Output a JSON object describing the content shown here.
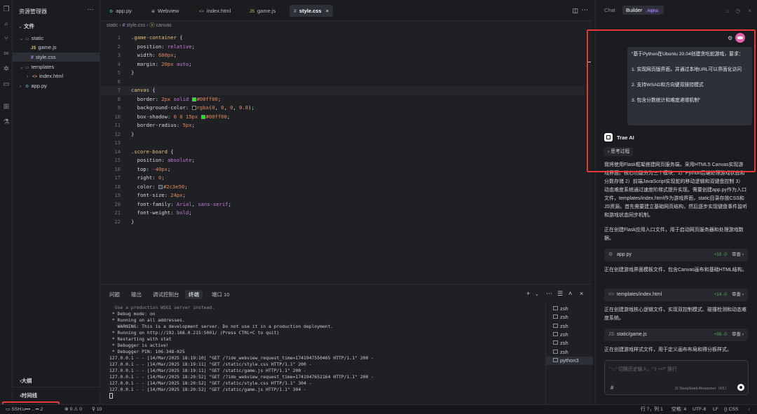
{
  "explorer": {
    "title": "资源管理器",
    "more": "···",
    "section_files": "文件",
    "items": [
      {
        "label": "static",
        "kind": "folder"
      },
      {
        "label": "game.js",
        "kind": "js"
      },
      {
        "label": "style.css",
        "kind": "css"
      },
      {
        "label": "templates",
        "kind": "folder"
      },
      {
        "label": "index.html",
        "kind": "html"
      },
      {
        "label": "app.py",
        "kind": "py"
      }
    ],
    "outline": "大纲",
    "timeline": "时间线"
  },
  "tabs": [
    {
      "icon": "py",
      "label": "app.py"
    },
    {
      "icon": "web",
      "label": "Webview"
    },
    {
      "icon": "<>",
      "label": "index.html"
    },
    {
      "icon": "JS",
      "label": "game.js"
    },
    {
      "icon": "#",
      "label": "style.css",
      "close": "×"
    }
  ],
  "breadcrumb": {
    "p1": "static",
    "p2": "style.css",
    "p3": "canvas"
  },
  "code": [
    {
      "n": "1",
      "t": ".game-container {"
    },
    {
      "n": "2",
      "t": "  position: relative;"
    },
    {
      "n": "3",
      "t": "  width: 600px;"
    },
    {
      "n": "4",
      "t": "  margin: 20px auto;"
    },
    {
      "n": "5",
      "t": "}"
    },
    {
      "n": "6",
      "t": ""
    },
    {
      "n": "7",
      "t": "canvas {"
    },
    {
      "n": "8",
      "t": "  border: 2px solid #00ff00;"
    },
    {
      "n": "9",
      "t": "  background-color: rgba(0, 0, 0, 0.8);"
    },
    {
      "n": "10",
      "t": "  box-shadow: 0 0 15px #00ff00;"
    },
    {
      "n": "11",
      "t": "  border-radius: 5px;"
    },
    {
      "n": "12",
      "t": "}"
    },
    {
      "n": "13",
      "t": ""
    },
    {
      "n": "14",
      "t": ".score-board {"
    },
    {
      "n": "15",
      "t": "  position: absolute;"
    },
    {
      "n": "16",
      "t": "  top: -40px;"
    },
    {
      "n": "17",
      "t": "  right: 0;"
    },
    {
      "n": "18",
      "t": "  color: #2c3e50;"
    },
    {
      "n": "19",
      "t": "  font-size: 24px;"
    },
    {
      "n": "20",
      "t": "  font-family: Arial, sans-serif;"
    },
    {
      "n": "21",
      "t": "  font-weight: bold;"
    },
    {
      "n": "22",
      "t": "}"
    }
  ],
  "panel": {
    "tabs": [
      "问题",
      "输出",
      "调试控制台",
      "终端",
      "端口"
    ],
    "port_count": "10",
    "terminal_lines": [
      "  Use a production WSGI server instead.",
      " * Debug mode: on",
      " * Running on all addresses.",
      "   WARNING: This is a development server. Do not use it in a production deployment.",
      " * Running on http://192.168.0.215:5001/ (Press CTRL+C to quit)",
      " * Restarting with stat",
      " * Debugger is active!",
      " * Debugger PIN: 106-348-025",
      "127.0.0.1 - - [14/Mar/2025 18:19:10] \"GET /?ide_webview_request_time=1741947550465 HTTP/1.1\" 200 -",
      "127.0.0.1 - - [14/Mar/2025 18:19:11] \"GET /static/style.css HTTP/1.1\" 200 -",
      "127.0.0.1 - - [14/Mar/2025 18:19:11] \"GET /static/game.js HTTP/1.1\" 200 -",
      "127.0.0.1 - - [14/Mar/2025 18:20:52] \"GET /?ide_webview_request_time=1741947652164 HTTP/1.1\" 200 -",
      "127.0.0.1 - - [14/Mar/2025 18:20:52] \"GET /static/style.css HTTP/1.1\" 304 -",
      "127.0.0.1 - - [14/Mar/2025 18:20:52] \"GET /static/game.js HTTP/1.1\" 304 -"
    ],
    "terminals": [
      "zsh",
      "zsh",
      "zsh",
      "zsh",
      "zsh",
      "zsh",
      "python3"
    ]
  },
  "right": {
    "tab_chat": "Chat",
    "tab_builder": "Builder",
    "alpha": "Alpha",
    "user_msg": [
      "\"基于Python在Ubuntu 20.04创建贪吃蛇游戏，要求：",
      "",
      "1. 实现网页版界面，并通过本地URL可以界面化访问",
      "",
      "2. 支持WSAD和方向键双操控模式",
      "",
      "3. 包含分数统计和难度递增机制\""
    ],
    "ai_name": "Trae AI",
    "thinking": "思考过程",
    "reply": "我将使用Flask框架搭建网页服务端，采用HTML5 Canvas实现游戏界面。核心功能分为三个模块：1）Python后端处理游戏状态和分数存储 2）前端JavaScript实现蛇的移动逻辑和双键盘控制 3）动态难度系统通过速度阶梯式提升实现。需要创建app.py作为入口文件，templates/index.html作为游戏界面，static目录存放CSS和JS资源。首先需要建立基础网页结构，然后逐步实现键盘事件监听和游戏状态同步机制。",
    "step1": "正在创建Flask应用入口文件，用于启动网页服务器和处理游戏数据。",
    "file1": {
      "name": "app.py",
      "add": "+18 -0",
      "review": "审查 ›"
    },
    "step2": "正在创建游戏界面模板文件，包含Canvas画布和基础HTML结构。",
    "file2": {
      "name": "templates/index.html",
      "add": "+14 -0",
      "review": "审查 ›"
    },
    "step3": "正在创建游戏核心逻辑文件，实现双控制模式、碰撞检测和动态难度系统。",
    "file3": {
      "name": "static/game.js",
      "add": "+99 -0",
      "review": "审查 ›"
    },
    "step4": "正在创建游戏样式文件，用于定义画布布局和得分板样式。",
    "input_placeholder": "\"↑↓\" 切换历史输入，\"⇧+⏎\" 换行",
    "hash": "#",
    "model": "DeepSeek-Reasoner（R1）"
  },
  "status": {
    "ssh": "SSH:u▪▪▪ .. ▪▪.2",
    "errors": "⊗ 0",
    "warnings": "⚠ 0",
    "ports": "10",
    "cursor": "行 7，列 1",
    "spaces": "空格: 4",
    "encoding": "UTF-8",
    "eol": "LF",
    "lang": "CSS"
  },
  "colors": {
    "accent_red": "#e53935",
    "green": "#00ff00"
  }
}
